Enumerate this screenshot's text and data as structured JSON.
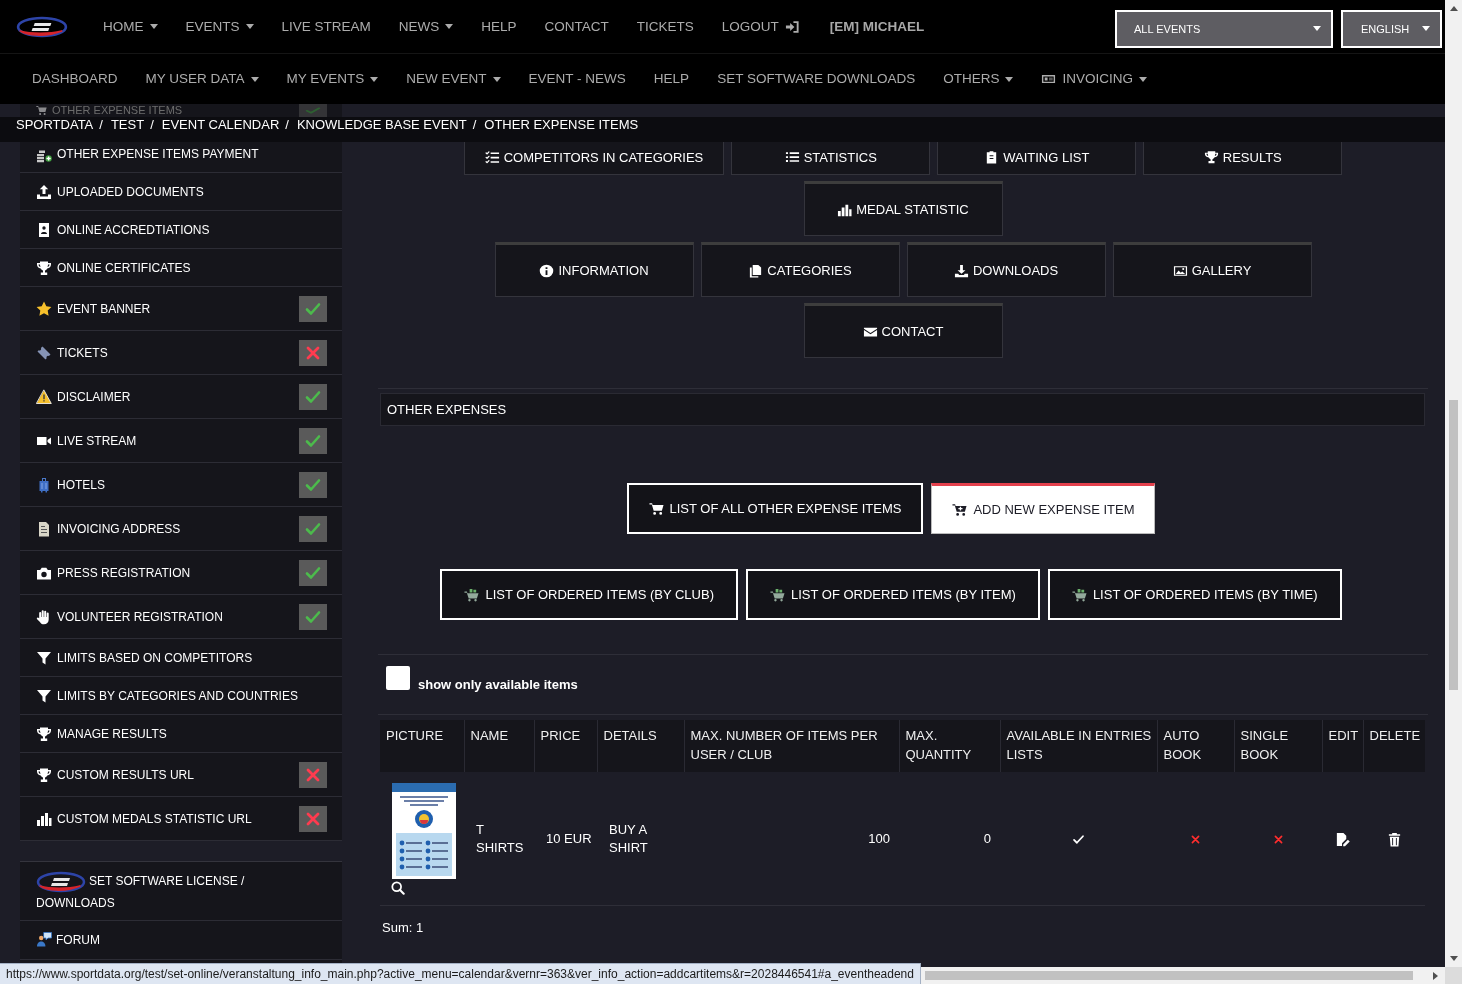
{
  "top_nav": {
    "items": [
      {
        "label": "HOME",
        "dropdown": true
      },
      {
        "label": "EVENTS",
        "dropdown": true
      },
      {
        "label": "LIVE STREAM",
        "dropdown": false
      },
      {
        "label": "NEWS",
        "dropdown": true
      },
      {
        "label": "HELP",
        "dropdown": false
      },
      {
        "label": "CONTACT",
        "dropdown": false
      },
      {
        "label": "TICKETS",
        "dropdown": false
      },
      {
        "label": "LOGOUT",
        "dropdown": false
      }
    ],
    "user": "[EM] MICHAEL",
    "event_select": {
      "value": "ALL EVENTS"
    },
    "language_select": {
      "value": "ENGLISH"
    }
  },
  "sub_nav": {
    "items": [
      {
        "label": "DASHBOARD",
        "dropdown": false
      },
      {
        "label": "MY USER DATA",
        "dropdown": true
      },
      {
        "label": "MY EVENTS",
        "dropdown": true
      },
      {
        "label": "NEW EVENT",
        "dropdown": true
      },
      {
        "label": "EVENT - NEWS",
        "dropdown": false
      },
      {
        "label": "HELP",
        "dropdown": false
      },
      {
        "label": "SET SOFTWARE DOWNLOADS",
        "dropdown": false
      },
      {
        "label": "OTHERS",
        "dropdown": true
      },
      {
        "label": "INVOICING",
        "dropdown": true
      }
    ]
  },
  "breadcrumb": {
    "separator": "/",
    "items": [
      "SPORTDATA",
      "TEST",
      "EVENT CALENDAR",
      "KNOWLEDGE BASE EVENT",
      "OTHER EXPENSE ITEMS"
    ]
  },
  "sidebar": {
    "items": [
      {
        "label": "OTHER EXPENSE ITEMS",
        "kind": "toggle",
        "enabled": true
      },
      {
        "label": "OTHER EXPENSE ITEMS PAYMENT",
        "kind": "link"
      },
      {
        "label": "UPLOADED DOCUMENTS",
        "kind": "link"
      },
      {
        "label": "ONLINE ACCREDTIATIONS",
        "kind": "link"
      },
      {
        "label": "ONLINE CERTIFICATES",
        "kind": "link"
      },
      {
        "label": "EVENT BANNER",
        "kind": "toggle",
        "enabled": true
      },
      {
        "label": "TICKETS",
        "kind": "toggle",
        "enabled": false
      },
      {
        "label": "DISCLAIMER",
        "kind": "toggle",
        "enabled": true
      },
      {
        "label": "LIVE STREAM",
        "kind": "toggle",
        "enabled": true
      },
      {
        "label": "HOTELS",
        "kind": "toggle",
        "enabled": true
      },
      {
        "label": "INVOICING ADDRESS",
        "kind": "toggle",
        "enabled": true
      },
      {
        "label": "PRESS REGISTRATION",
        "kind": "toggle",
        "enabled": true
      },
      {
        "label": "VOLUNTEER REGISTRATION",
        "kind": "toggle",
        "enabled": true
      },
      {
        "label": "LIMITS BASED ON COMPETITORS",
        "kind": "link"
      },
      {
        "label": "LIMITS BY CATEGORIES AND COUNTRIES",
        "kind": "link"
      },
      {
        "label": "MANAGE RESULTS",
        "kind": "link"
      },
      {
        "label": "CUSTOM RESULTS URL",
        "kind": "toggle",
        "enabled": false
      },
      {
        "label": "CUSTOM MEDALS STATISTIC URL",
        "kind": "toggle",
        "enabled": false
      }
    ],
    "footer_items": [
      {
        "label": "SET SOFTWARE LICENSE / DOWNLOADS"
      },
      {
        "label": "FORUM"
      }
    ]
  },
  "event_menu": {
    "rows": [
      {
        "buttons": [
          "COMPETITORS IN CATEGORIES",
          "STATISTICS",
          "WAITING LIST",
          "RESULTS"
        ]
      },
      {
        "buttons": [
          "MEDAL STATISTIC"
        ]
      },
      {
        "buttons": [
          "INFORMATION",
          "CATEGORIES",
          "DOWNLOADS",
          "GALLERY"
        ]
      },
      {
        "buttons": [
          "CONTACT"
        ]
      }
    ]
  },
  "other_expenses": {
    "title": "OTHER EXPENSES",
    "tabs": [
      {
        "label": "LIST OF ALL OTHER EXPENSE ITEMS",
        "selected": false
      },
      {
        "label": "ADD NEW EXPENSE ITEM",
        "selected": true
      }
    ],
    "report_buttons": [
      "LIST OF ORDERED ITEMS (BY CLUB)",
      "LIST OF ORDERED ITEMS (BY ITEM)",
      "LIST OF ORDERED ITEMS (BY TIME)"
    ],
    "filter": {
      "label": "show only available items",
      "checked": false
    },
    "table": {
      "columns": [
        "PICTURE",
        "NAME",
        "PRICE",
        "DETAILS",
        "MAX. NUMBER OF ITEMS PER USER / CLUB",
        "MAX. QUANTITY",
        "AVAILABLE IN ENTRIES LISTS",
        "AUTO BOOK",
        "SINGLE BOOK",
        "EDIT",
        "DELETE"
      ],
      "rows": [
        {
          "name": "T SHIRTS",
          "price": "10 EUR",
          "details": "BUY A SHIRT",
          "max_items_per_user_club": "100",
          "max_quantity": "0",
          "available_in_entries_lists": true,
          "auto_book": false,
          "single_book": false
        }
      ]
    },
    "sum": "Sum: 1"
  },
  "status_url": "https://www.sportdata.org/test/set-online/veranstaltung_info_main.php?active_menu=calendar&vernr=363&ver_info_action=addcartitems&r=2028446541#a_eventheadend"
}
